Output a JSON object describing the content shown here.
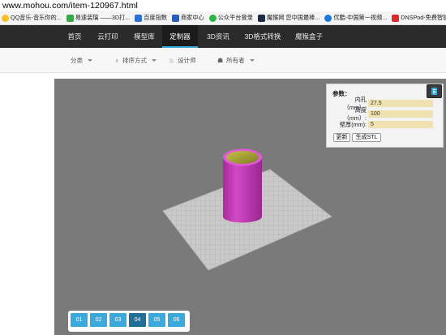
{
  "browser": {
    "url": "www.mohou.com/item-120967.html",
    "bookmarks": [
      {
        "label": "QQ音乐-音乐你的...",
        "color": "#f7c12b"
      },
      {
        "label": "易速装璃 ——3D打...",
        "color": "#39a84a"
      },
      {
        "label": "百度指数",
        "color": "#2f6fd1"
      },
      {
        "label": "商家中心",
        "color": "#2b5cb6"
      },
      {
        "label": "公众平台登录",
        "color": "#2cb34a"
      },
      {
        "label": "魔猴网 您中国最棒...",
        "color": "#1f2a44"
      },
      {
        "label": "优酷-中国第一视频...",
        "color": "#1a7bd6"
      },
      {
        "label": "DNSPod-免费智能...",
        "color": "#d92c2c"
      }
    ]
  },
  "nav": {
    "items": [
      {
        "label": "首页"
      },
      {
        "label": "云打印"
      },
      {
        "label": "模型库"
      },
      {
        "label": "定制器"
      },
      {
        "label": "3D资讯"
      },
      {
        "label": "3D格式转换"
      },
      {
        "label": "魔猴盒子"
      }
    ],
    "active": "定制器"
  },
  "subnav": {
    "category": "分类",
    "sort": "排序方式",
    "designer": "设计师",
    "owner": "所有者"
  },
  "params": {
    "title": "参数：",
    "rows": [
      {
        "label": "内孔（mm）:",
        "value": "27.5"
      },
      {
        "label": "高度（mm）:",
        "value": "100"
      },
      {
        "label": "壁厚(mm):",
        "value": "5"
      }
    ],
    "update_button": "更新",
    "stl_button": "生成STL"
  },
  "presets": {
    "items": [
      "01",
      "02",
      "03",
      "04",
      "05",
      "06"
    ],
    "active": "04"
  },
  "colors": {
    "nav_bg": "#2b2b2b",
    "accent": "#3aa9dc",
    "preset_active": "#1f6f99",
    "viewport_bg": "#7a7a7a",
    "model_magenta": "#c63bbf",
    "model_inner": "#a8a43a"
  }
}
